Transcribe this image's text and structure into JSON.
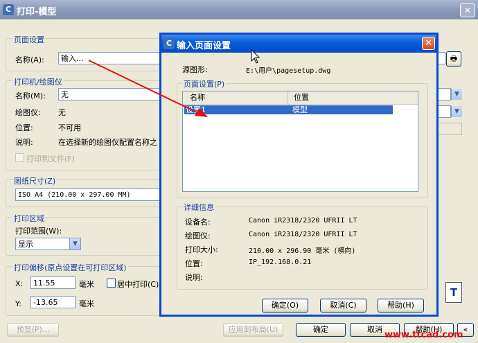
{
  "main_window": {
    "title": "打印-模型",
    "page_setup": {
      "group_label": "页面设置",
      "name_label": "名称(A):",
      "name_value": "输入..."
    },
    "printer": {
      "group_label": "打印机/绘图仪",
      "name_label": "名称(M):",
      "name_value": "无",
      "plotter_label": "绘图仪:",
      "plotter_value": "无",
      "location_label": "位置:",
      "location_value": "不可用",
      "desc_label": "说明:",
      "desc_value": "在选择新的绘图仪配置名称之",
      "print_to_file": "打印到文件(F)"
    },
    "paper_size": {
      "group_label": "图纸尺寸(Z)",
      "value": "ISO A4 (210.00 x 297.00 MM)"
    },
    "plot_area": {
      "group_label": "打印区域",
      "range_label": "打印范围(W):",
      "range_value": "显示"
    },
    "plot_offset": {
      "group_label": "打印偏移(原点设置在可打印区域)",
      "x_label": "X:",
      "x_value": "11.55",
      "y_label": "Y:",
      "y_value": "-13.65",
      "unit": "毫米",
      "center_label": "居中打印(C)"
    },
    "buttons": {
      "preview": "预览(P)...",
      "apply": "应用到布局(U)",
      "ok": "确定",
      "cancel": "取消",
      "help": "帮助(H)",
      "more": "«"
    }
  },
  "dialog": {
    "title": "输入页面设置",
    "source_label": "源图形:",
    "source_value": "E:\\用户\\pagesetup.dwg",
    "page_setups_label": "页面设置(P)",
    "columns": [
      "名称",
      "位置"
    ],
    "rows": [
      {
        "name": "设置1",
        "location": "模型"
      }
    ],
    "details_label": "详细信息",
    "details": [
      {
        "label": "设备名:",
        "value": "Canon iR2318/2320 UFRII LT"
      },
      {
        "label": "绘图仪:",
        "value": "Canon iR2318/2320 UFRII LT"
      },
      {
        "label": "打印大小:",
        "value": "210.00 x 296.90 毫米 (横向)"
      },
      {
        "label": "位置:",
        "value": "IP_192.168.0.21"
      },
      {
        "label": "说明:",
        "value": ""
      }
    ],
    "buttons": {
      "ok": "确定(O)",
      "cancel": "取消(C)",
      "help": "帮助(H)"
    }
  },
  "watermark": "www.ttcad.com",
  "colors": {
    "dialog_border": "#0b48d1",
    "selection": "#316ac5",
    "arrow": "#e01010"
  }
}
